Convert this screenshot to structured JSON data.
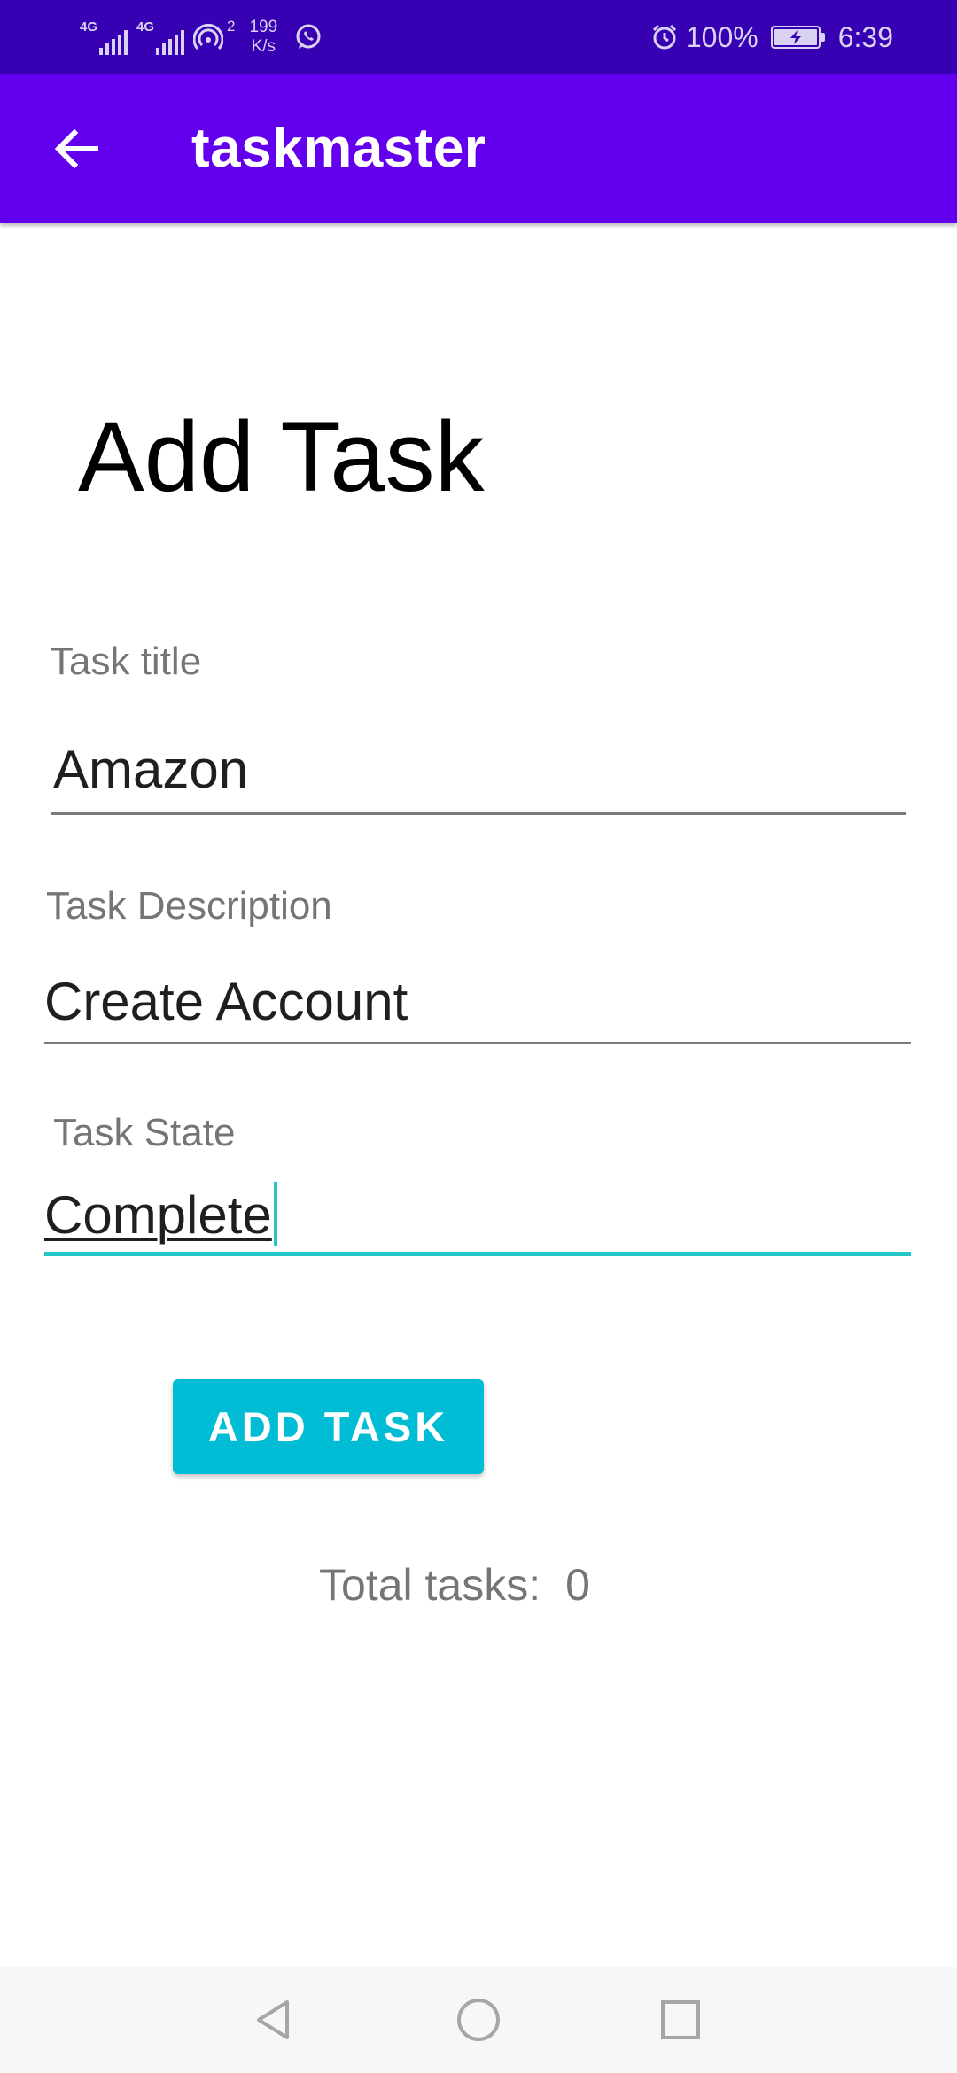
{
  "status_bar": {
    "sim1": "4G",
    "sim2": "4G",
    "hotspot_count": "2",
    "speed_value": "199",
    "speed_unit": "K/s",
    "battery": "100%",
    "time": "6:39"
  },
  "app_bar": {
    "title": "taskmaster",
    "back_icon": "arrow-back-icon"
  },
  "page": {
    "title": "Add Task"
  },
  "form": {
    "task_title_label": "Task title",
    "task_title_value": "Amazon",
    "task_description_label": "Task Description",
    "task_description_value": "Create Account",
    "task_state_label": "Task State",
    "task_state_value": "Complete",
    "submit_label": "ADD TASK"
  },
  "summary": {
    "total_label": "Total tasks:",
    "total_value": "0"
  },
  "nav_bar": {
    "back_icon": "triangle-back-icon",
    "home_icon": "circle-home-icon",
    "recents_icon": "square-recents-icon"
  },
  "colors": {
    "status_bar": "#3700B3",
    "app_bar": "#6200EE",
    "accent": "#26C6C6",
    "button": "#00BCD4"
  }
}
